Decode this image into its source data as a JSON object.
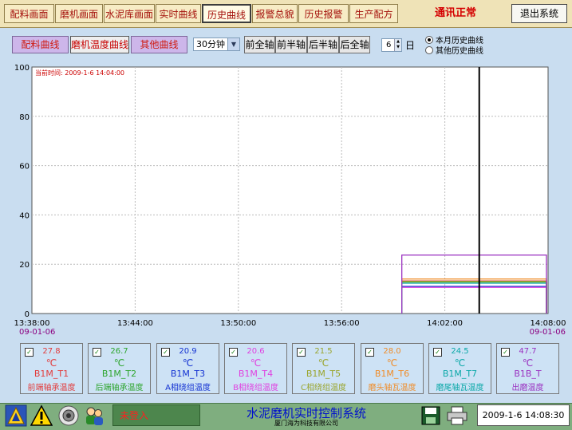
{
  "nav": {
    "tabs": [
      {
        "label": "配料画面"
      },
      {
        "label": "磨机画面"
      },
      {
        "label": "水泥库画面"
      },
      {
        "label": "实时曲线"
      },
      {
        "label": "历史曲线"
      },
      {
        "label": "报警总貌"
      },
      {
        "label": "历史报警"
      },
      {
        "label": "生产配方"
      }
    ],
    "active_tab": "历史曲线",
    "comm_status": "通讯正常",
    "exit_label": "退出系统"
  },
  "toolbar": {
    "curve_buttons": [
      {
        "label": "配料曲线"
      },
      {
        "label": "磨机温度曲线"
      },
      {
        "label": "其他曲线"
      }
    ],
    "interval_value": "30分钟",
    "axis_buttons": [
      {
        "label": "前全轴"
      },
      {
        "label": "前半轴"
      },
      {
        "label": "后半轴"
      },
      {
        "label": "后全轴"
      }
    ],
    "days_value": "6",
    "days_unit": "日",
    "radio_options": [
      {
        "label": "本月历史曲线",
        "selected": true
      },
      {
        "label": "其他历史曲线",
        "selected": false
      }
    ]
  },
  "chart_data": {
    "type": "line",
    "current_time_label": "当前时间: 2009-1-6 14:04:00",
    "yticks": [
      "100",
      "80",
      "60",
      "40",
      "20",
      "0"
    ],
    "ylim": [
      0,
      100
    ],
    "xticks": [
      "13:38:00",
      "13:44:00",
      "13:50:00",
      "13:56:00",
      "14:02:00",
      "14:08:00"
    ],
    "start_date": "09-01-06",
    "end_date": "09-01-06",
    "x_start": "13:38:00",
    "x_end": "14:08:00",
    "cursor_time": "14:04:00",
    "data_start_time": "13:59:30",
    "series": [
      {
        "name": "前端轴承温度",
        "color": "#e23c3c",
        "value": 13.2
      },
      {
        "name": "后端轴承温度",
        "color": "#2ea52e",
        "value": 12.8
      },
      {
        "name": "A相绕组温度",
        "color": "#1432d2",
        "value": 11.0
      },
      {
        "name": "B相绕组温度",
        "color": "#e040e0",
        "value": 10.6
      },
      {
        "name": "C相绕组温度",
        "color": "#9aa52e",
        "value": 13.0
      },
      {
        "name": "磨头轴瓦温度",
        "color": "#f08c28",
        "value": 14.0
      },
      {
        "name": "磨尾轴瓦温度",
        "color": "#0aa8a8",
        "value": 12.3
      },
      {
        "name": "出磨温度",
        "color": "#9a30c0",
        "value": 23.7
      }
    ]
  },
  "sensors": [
    {
      "value": "27.8",
      "unit": "℃",
      "tag": "B1M_T1",
      "label": "前端轴承温度",
      "color": "#e23c3c",
      "checked": "✓"
    },
    {
      "value": "26.7",
      "unit": "℃",
      "tag": "B1M_T2",
      "label": "后端轴承温度",
      "color": "#2ea52e",
      "checked": "✓"
    },
    {
      "value": "20.9",
      "unit": "℃",
      "tag": "B1M_T3",
      "label": "A相绕组温度",
      "color": "#1432d2",
      "checked": "✓"
    },
    {
      "value": "20.6",
      "unit": "℃",
      "tag": "B1M_T4",
      "label": "B相绕组温度",
      "color": "#e040e0",
      "checked": "✓"
    },
    {
      "value": "21.5",
      "unit": "℃",
      "tag": "B1M_T5",
      "label": "C相绕组温度",
      "color": "#9aa52e",
      "checked": "✓"
    },
    {
      "value": "28.0",
      "unit": "℃",
      "tag": "B1M_T6",
      "label": "磨头轴瓦温度",
      "color": "#f08c28",
      "checked": "✓"
    },
    {
      "value": "24.5",
      "unit": "℃",
      "tag": "B1M_T7",
      "label": "磨尾轴瓦温度",
      "color": "#0aa8a8",
      "checked": "✓"
    },
    {
      "value": "47.7",
      "unit": "℃",
      "tag": "B1B_T",
      "label": "出磨温度",
      "color": "#9a30c0",
      "checked": "✓"
    }
  ],
  "status": {
    "login": "未登入",
    "system_title": "水泥磨机实时控制系统",
    "company": "厦门海为科技有限公司",
    "datetime": "2009-1-6 14:08:30"
  }
}
